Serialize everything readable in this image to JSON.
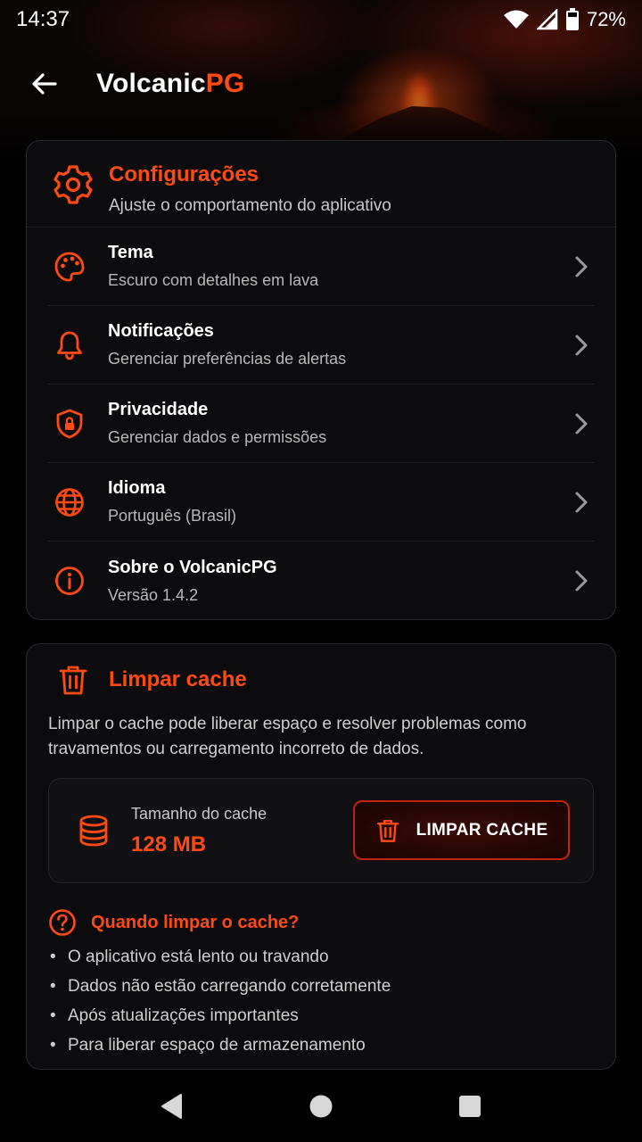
{
  "status_bar": {
    "time": "14:37",
    "battery": "72%",
    "icons": [
      "wifi-icon",
      "signal-icon",
      "battery-icon"
    ]
  },
  "app_bar": {
    "title_main": "Volcanic",
    "title_accent": "PG",
    "back_icon": "arrow-left-icon"
  },
  "settings": {
    "title": "Configurações",
    "subtitle": "Ajuste o comportamento do aplicativo",
    "icon": "gear-icon",
    "items": [
      {
        "title": "Tema",
        "subtitle": "Escuro com detalhes em lava",
        "icon": "palette-icon"
      },
      {
        "title": "Notificações",
        "subtitle": "Gerenciar preferências de alertas",
        "icon": "bell-icon"
      },
      {
        "title": "Privacidade",
        "subtitle": "Gerenciar dados e permissões",
        "icon": "shield-lock-icon"
      },
      {
        "title": "Idioma",
        "subtitle": "Português (Brasil)",
        "icon": "globe-icon"
      },
      {
        "title": "Sobre o VolcanicPG",
        "subtitle": "Versão 1.4.2",
        "icon": "info-icon"
      }
    ]
  },
  "cache": {
    "title": "Limpar cache",
    "icon": "trash-icon",
    "description": "Limpar o cache pode liberar espaço e resolver problemas como travamentos ou carregamento incorreto de dados.",
    "size_label": "Tamanho do cache",
    "size_value": "128 MB",
    "button_label": "LIMPAR CACHE",
    "when_title": "Quando limpar o cache?",
    "when_items": [
      "O aplicativo está lento ou travando",
      "Dados não estão carregando corretamente",
      "Após atualizações importantes",
      "Para liberar espaço de armazenamento"
    ]
  },
  "colors": {
    "accent": "#ff4a14",
    "background": "#000000",
    "card": "#0c0c0e"
  }
}
